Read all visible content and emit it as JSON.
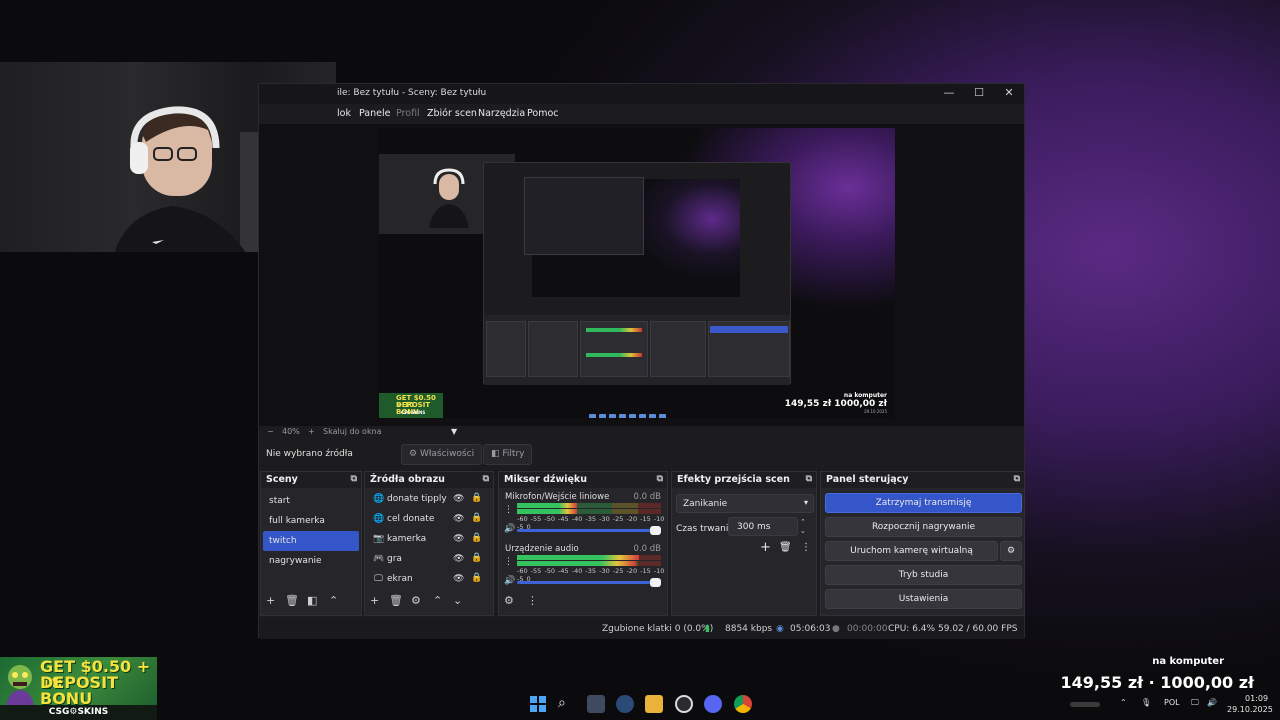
{
  "window": {
    "title": "ile: Bez tytułu - Sceny: Bez tytułu",
    "controls": [
      "—",
      "☐",
      "✕"
    ]
  },
  "menu": {
    "items": [
      "lok",
      "Panele",
      "Profil",
      "Zbiór scen",
      "Narzędzia",
      "Pomoc"
    ]
  },
  "preview_overlay": {
    "ad_line1": "GET $0.50 + 10",
    "ad_line2": "DEPOSIT BONU",
    "ad_brand": "CSG SKINS",
    "donate_title": "na komputer",
    "donate_amount": "149,55 zł  1000,00 zł",
    "donate_date": "29.10.2025"
  },
  "zoom": {
    "minus": "−",
    "level": "40%",
    "plus": "+",
    "mode": "Skaluj do okna",
    "caret": "▼"
  },
  "source_bar": {
    "label": "Nie wybrano źródła",
    "properties": "Właściwości",
    "filters": "Filtry"
  },
  "scenes": {
    "title": "Sceny",
    "items": [
      "start",
      "full kamerka",
      "twitch",
      "nagrywanie"
    ],
    "selected": "twitch"
  },
  "sources": {
    "title": "Źródła obrazu",
    "items": [
      {
        "name": "donate tipply",
        "icon": "globe-icon"
      },
      {
        "name": "cel donate",
        "icon": "globe-icon"
      },
      {
        "name": "kamerka",
        "icon": "camera-icon"
      },
      {
        "name": "gra",
        "icon": "gamepad-icon"
      },
      {
        "name": "ekran",
        "icon": "monitor-icon"
      }
    ]
  },
  "mixer": {
    "title": "Mikser dźwięku",
    "channels": [
      {
        "name": "Mikrofon/Wejście liniowe",
        "db": "0.0 dB",
        "level": 0.42
      },
      {
        "name": "Urządzenie audio",
        "db": "0.0 dB",
        "level": 0.85
      }
    ],
    "scale": "-60 -55 -50 -45 -40 -35 -30 -25 -20 -15 -10 -5 0"
  },
  "transitions": {
    "title": "Efekty przejścia scen",
    "selected": "Zanikanie",
    "duration_label": "Czas trwania",
    "duration_value": "300 ms"
  },
  "controls": {
    "title": "Panel sterujący",
    "stop_stream": "Zatrzymaj transmisję",
    "start_recording": "Rozpocznij nagrywanie",
    "virtual_camera": "Uruchom kamerę wirtualną",
    "studio_mode": "Tryb studia",
    "settings": "Ustawienia"
  },
  "status": {
    "dropped": "Zgubione klatki 0 (0.0%)",
    "bitrate": "8854 kbps",
    "stream_time": "05:06:03",
    "rec_time": "00:00:00",
    "cpu": "CPU: 6.4%",
    "fps": "59.02 / 60.00 FPS"
  },
  "bottom_ad": {
    "line1": "GET $0.50 + 10",
    "line2": "DEPOSIT BONU",
    "brand": "CSG⚙SKINS"
  },
  "donate": {
    "title": "na komputer",
    "amount": "149,55 zł · 1000,00 zł"
  },
  "taskbar": {
    "apps": [
      "windows-start-icon",
      "search-icon",
      "store-icon",
      "steam-icon",
      "folder-icon",
      "obs-icon",
      "discord-icon",
      "chrome-icon"
    ],
    "lang": "POL",
    "time": "01:09",
    "date": "29.10.2025"
  },
  "colors": {
    "accent": "#3456c8",
    "panel": "#26262a",
    "meter_green": "#35c35f",
    "meter_yellow": "#e3c53c",
    "meter_red": "#d13b3b"
  }
}
